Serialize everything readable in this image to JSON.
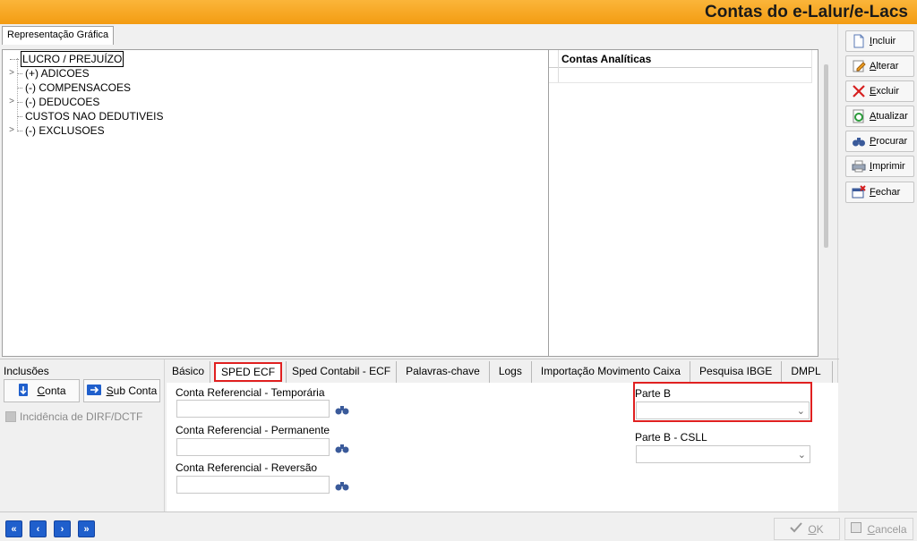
{
  "window": {
    "title": "Contas do e-Lalur/e-Lacs"
  },
  "top_tab": {
    "label": "Representação Gráfica"
  },
  "tree": {
    "items": [
      {
        "label": "LUCRO / PREJUÍZO",
        "expandable": false,
        "selected": true
      },
      {
        "label": "(+) ADICOES",
        "expandable": true,
        "selected": false
      },
      {
        "label": "(-) COMPENSACOES",
        "expandable": false,
        "selected": false
      },
      {
        "label": "(-) DEDUCOES",
        "expandable": true,
        "selected": false
      },
      {
        "label": "CUSTOS NAO DEDUTIVEIS",
        "expandable": false,
        "selected": false
      },
      {
        "label": "(-) EXCLUSOES",
        "expandable": true,
        "selected": false
      }
    ]
  },
  "contas_analiticas": {
    "header": "Contas Analíticas"
  },
  "side_buttons": [
    {
      "key": "I",
      "rest": "ncluir",
      "icon": "document-icon"
    },
    {
      "key": "A",
      "rest": "lterar",
      "icon": "pencil-icon"
    },
    {
      "key": "E",
      "rest": "xcluir",
      "icon": "delete-x-icon"
    },
    {
      "key": "A",
      "rest": "tualizar",
      "icon": "refresh-icon"
    },
    {
      "key": "P",
      "rest": "rocurar",
      "icon": "binoculars-icon"
    },
    {
      "key": "I",
      "rest": "mprimir",
      "icon": "printer-icon"
    },
    {
      "key": "F",
      "rest": "echar",
      "icon": "close-window-icon"
    }
  ],
  "inclusoes": {
    "label": "Inclusões",
    "conta_key": "C",
    "conta_rest": "onta",
    "sub_key": "S",
    "sub_rest": "ub Conta",
    "checkbox_label": "Incidência de DIRF/DCTF"
  },
  "tabs": [
    "Básico",
    "SPED ECF",
    "Sped Contabil - ECF",
    "Palavras-chave",
    "Logs",
    "Importação Movimento Caixa",
    "Pesquisa IBGE",
    "DMPL"
  ],
  "active_tab": "SPED ECF",
  "sped_ecf": {
    "conta_temp_label": "Conta Referencial - Temporária",
    "conta_temp_value": "",
    "conta_perm_label": "Conta Referencial - Permanente",
    "conta_perm_value": "",
    "conta_rev_label": "Conta Referencial - Reversão",
    "conta_rev_value": "",
    "parte_b_label": "Parte B",
    "parte_b_value": "",
    "parte_b_csll_label": "Parte B - CSLL",
    "parte_b_csll_value": ""
  },
  "footer": {
    "ok_key": "O",
    "ok_rest": "K",
    "cancel_key": "C",
    "cancel_rest": "ancela"
  },
  "colors": {
    "title_bar": "#f5a623",
    "highlight": "#e02020",
    "nav_blue": "#1f5fcc"
  }
}
